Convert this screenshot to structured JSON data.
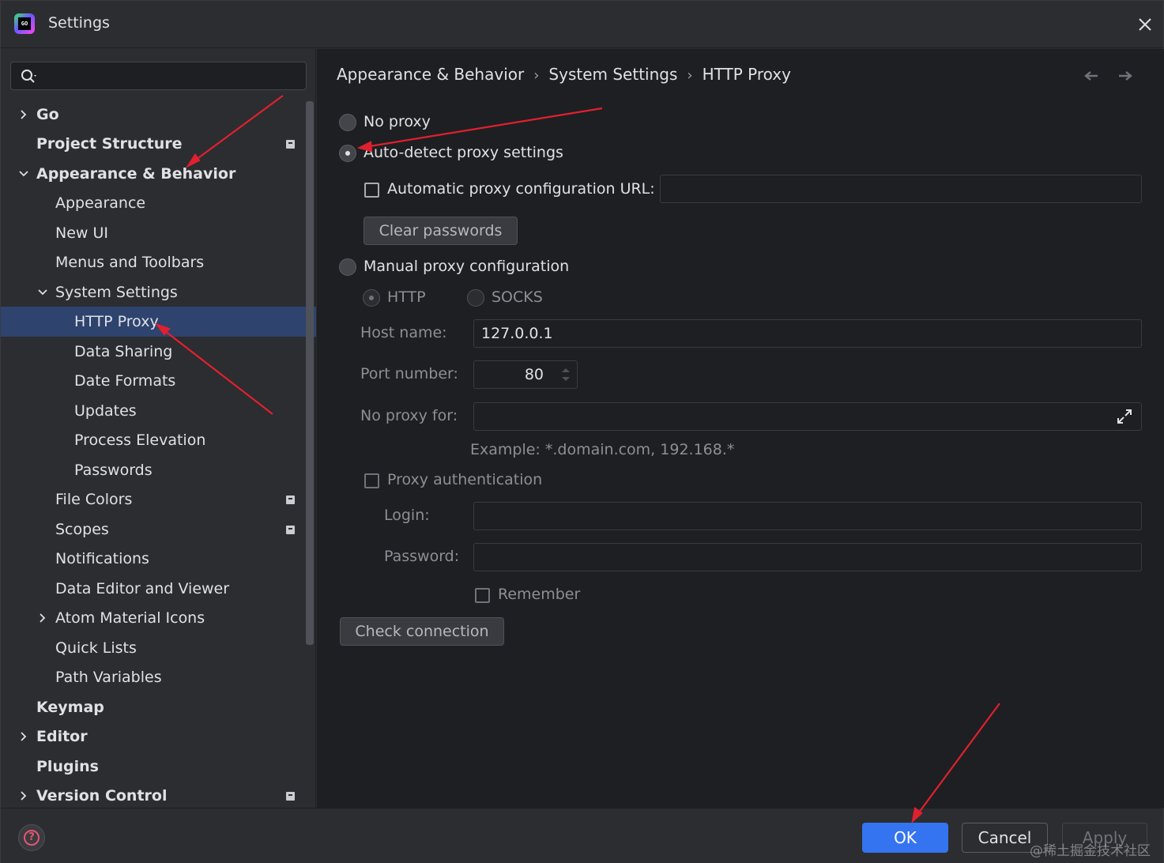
{
  "window": {
    "title": "Settings",
    "logo_text": "GO"
  },
  "search": {
    "placeholder": "",
    "value": ""
  },
  "sidebar": {
    "items": [
      {
        "label": "Go",
        "bold": true
      },
      {
        "label": "Project Structure",
        "bold": true
      },
      {
        "label": "Appearance & Behavior",
        "bold": true
      },
      {
        "label": "Appearance"
      },
      {
        "label": "New UI"
      },
      {
        "label": "Menus and Toolbars"
      },
      {
        "label": "System Settings"
      },
      {
        "label": "HTTP Proxy",
        "selected": true
      },
      {
        "label": "Data Sharing"
      },
      {
        "label": "Date Formats"
      },
      {
        "label": "Updates"
      },
      {
        "label": "Process Elevation"
      },
      {
        "label": "Passwords"
      },
      {
        "label": "File Colors"
      },
      {
        "label": "Scopes"
      },
      {
        "label": "Notifications"
      },
      {
        "label": "Data Editor and Viewer"
      },
      {
        "label": "Atom Material Icons"
      },
      {
        "label": "Quick Lists"
      },
      {
        "label": "Path Variables"
      },
      {
        "label": "Keymap",
        "bold": true
      },
      {
        "label": "Editor",
        "bold": true
      },
      {
        "label": "Plugins",
        "bold": true
      },
      {
        "label": "Version Control",
        "bold": true
      }
    ]
  },
  "breadcrumb": {
    "items": [
      "Appearance & Behavior",
      "System Settings",
      "HTTP Proxy"
    ],
    "separator": "›"
  },
  "proxy": {
    "no_proxy_label": "No proxy",
    "auto_detect_label": "Auto-detect proxy settings",
    "auto_config_url_label": "Automatic proxy configuration URL:",
    "auto_config_url_value": "",
    "clear_passwords_label": "Clear passwords",
    "manual_label": "Manual proxy configuration",
    "http_label": "HTTP",
    "socks_label": "SOCKS",
    "host_label": "Host name:",
    "host_value": "127.0.0.1",
    "port_label": "Port number:",
    "port_value": "80",
    "no_proxy_for_label": "No proxy for:",
    "no_proxy_for_value": "",
    "example_text": "Example: *.domain.com, 192.168.*",
    "auth_label": "Proxy authentication",
    "login_label": "Login:",
    "login_value": "",
    "password_label": "Password:",
    "password_value": "",
    "remember_label": "Remember",
    "check_connection_label": "Check connection",
    "selected_mode": "auto-detect"
  },
  "footer": {
    "ok_label": "OK",
    "cancel_label": "Cancel",
    "apply_label": "Apply"
  },
  "watermark": "@稀土掘金技术社区",
  "colors": {
    "accent": "#3574f0",
    "selection": "#2e436e",
    "annotation_arrow": "#e0202e",
    "help": "#e5566f"
  }
}
